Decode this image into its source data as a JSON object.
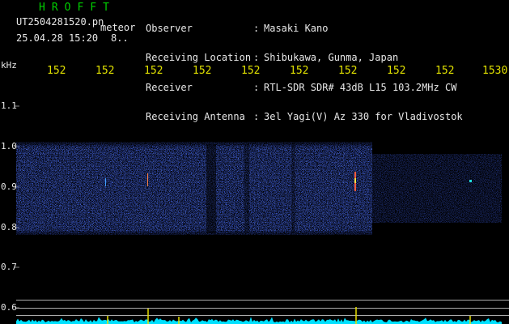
{
  "app": {
    "name": "HROFFT"
  },
  "file": {
    "name": "UT2504281520.pn",
    "mode": "meteor",
    "timestamp": "25.04.28 15:20",
    "extra": "8.."
  },
  "info": {
    "labels": [
      "Observer",
      "Receiving Location",
      "Receiver",
      "Receiving Antenna"
    ],
    "values": [
      "Masaki Kano",
      "Shibukawa, Gunma, Japan",
      "RTL-SDR SDR# 43dB L15 103.2MHz CW",
      "3el Yagi(V) Az 330 for Vladivostok"
    ]
  },
  "y_axis": {
    "unit": "kHz",
    "ticks": [
      "1.1",
      "1.0",
      "0.9",
      "0.8",
      "0.7",
      "0.6"
    ]
  },
  "x_axis": {
    "ticks": [
      "152",
      "152",
      "152",
      "152",
      "152",
      "152",
      "152",
      "152",
      "152",
      "1530"
    ]
  },
  "colors": {
    "background": "#000000",
    "axis_text": "#e8e8e8",
    "x_ticks": "#e0e000",
    "title": "#00d000",
    "noise": "#1a2acc",
    "spectrum": "#00e8ff"
  }
}
